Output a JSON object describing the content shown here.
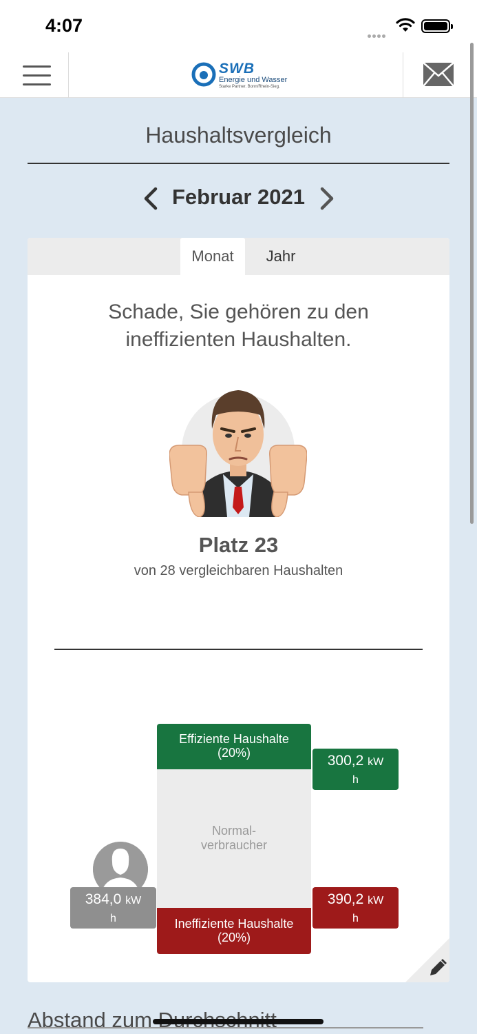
{
  "status_bar": {
    "time": "4:07"
  },
  "header": {
    "logo_name": "SWB",
    "logo_line1": "Energie und Wasser",
    "logo_line2": "Starke Partner. Bonn/Rhein-Sieg."
  },
  "page": {
    "title": "Haushaltsvergleich",
    "period": "Februar 2021"
  },
  "tabs": [
    {
      "label": "Monat",
      "active": true
    },
    {
      "label": "Jahr",
      "active": false
    }
  ],
  "result": {
    "headline_line1": "Schade, Sie gehören zu den",
    "headline_line2": "ineffizienten Haushalten.",
    "rank": "Platz 23",
    "rank_sub": "von 28 vergleichbaren Haushalten"
  },
  "comparison": {
    "efficient_label_1": "Effiziente Haushalte",
    "efficient_label_2": "(20%)",
    "efficient_value": "300,2",
    "normal_label_1": "Normal-",
    "normal_label_2": "verbraucher",
    "inefficient_label_1": "Ineffiziente Haushalte",
    "inefficient_label_2": "(20%)",
    "inefficient_value": "390,2",
    "own_value": "384,0",
    "unit_1": "kW",
    "unit_2": "h"
  },
  "next_section": {
    "title": "Abstand zum Durchschnitt"
  },
  "colors": {
    "efficient": "#187540",
    "inefficient": "#9e1a1a",
    "own": "#8f8f8f",
    "background": "#dde8f2"
  },
  "icons": [
    "menu-icon",
    "mail-icon",
    "chevron-left-icon",
    "chevron-right-icon",
    "pencil-icon",
    "user-silhouette-icon",
    "wifi-icon",
    "battery-icon"
  ]
}
